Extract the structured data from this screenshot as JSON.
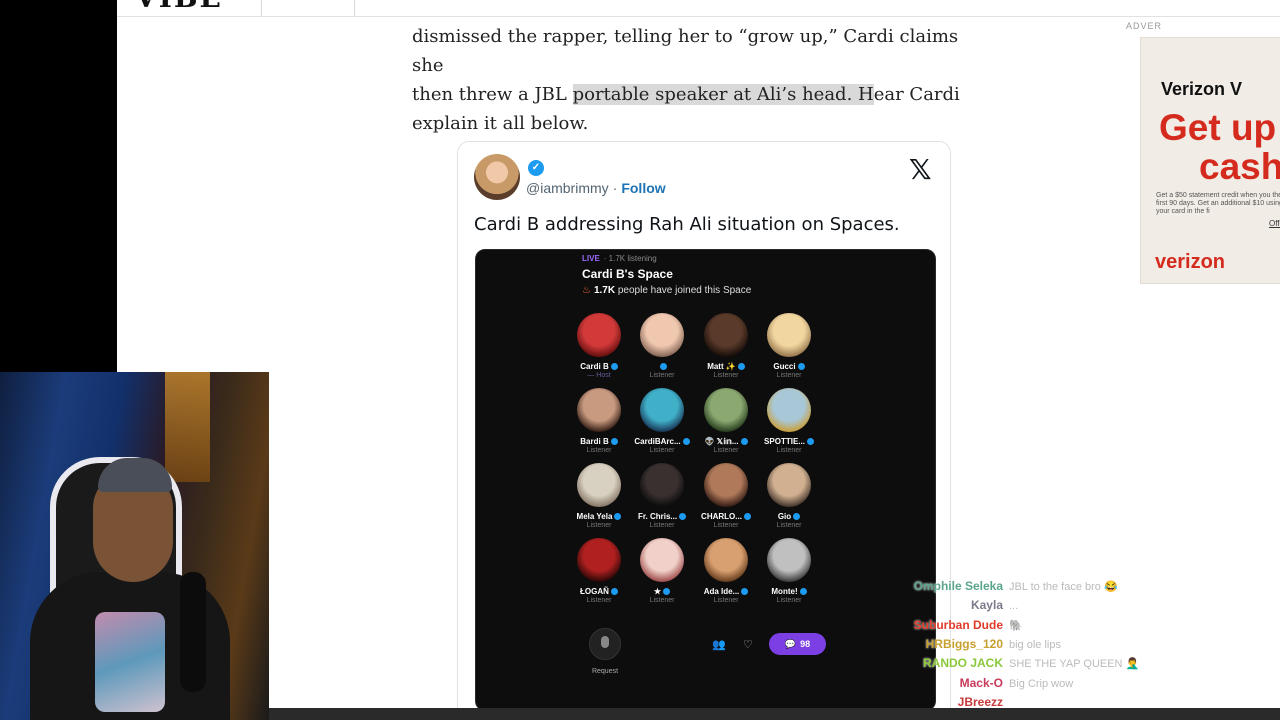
{
  "site": {
    "logo_fragment": "VIBE"
  },
  "article": {
    "line1": "dismissed the rapper, telling her to “grow up,” Cardi claims she",
    "line2_a": "then threw a JBL ",
    "line2_highlight": "portable speaker at Ali’s head. H",
    "line2_b": "ear Cardi",
    "line3": "explain it all below."
  },
  "tweet": {
    "handle": "@iambrimmy",
    "separator": "·",
    "follow_label": "Follow",
    "x_logo": "𝕏",
    "text": "Cardi B addressing Rah Ali situation on Spaces.",
    "space": {
      "live_label": "LIVE",
      "listening": "· 1.7K listening",
      "title": "Cardi B's Space",
      "joined_count": "1.7K",
      "joined_text": " people have joined this Space",
      "participants": [
        {
          "name": "Cardi B",
          "role": "— Host",
          "colors": [
            "#d23a3a",
            "#6a1010"
          ]
        },
        {
          "name": "",
          "role": "Listener",
          "colors": [
            "#f0c8b0",
            "#8a6a5a"
          ]
        },
        {
          "name": "Matt ✨",
          "role": "Listener",
          "colors": [
            "#5a3a2a",
            "#1a0f0a"
          ]
        },
        {
          "name": "Gucci",
          "role": "Listener",
          "colors": [
            "#f1d6a0",
            "#9a7a50"
          ]
        },
        {
          "name": "Bardi B",
          "role": "Listener",
          "colors": [
            "#c89a80",
            "#3a2218"
          ]
        },
        {
          "name": "CardiBArc...",
          "role": "Listener",
          "colors": [
            "#40b0c8",
            "#1a3a5a"
          ]
        },
        {
          "name": "👽 𝕏𝕚𝕟...",
          "role": "Listener",
          "colors": [
            "#8aa870",
            "#2a4020"
          ]
        },
        {
          "name": "SPOTTIE...",
          "role": "Listener",
          "colors": [
            "#a8c8d8",
            "#c8a040"
          ]
        },
        {
          "name": "Mela Yela",
          "role": "Listener",
          "colors": [
            "#d8d0c0",
            "#8a7a6a"
          ]
        },
        {
          "name": "Fr. Chris...",
          "role": "Listener",
          "colors": [
            "#3a3030",
            "#0d0d0d"
          ]
        },
        {
          "name": "CHARLO...",
          "role": "Listener",
          "colors": [
            "#b07a5a",
            "#3a2018"
          ]
        },
        {
          "name": "Gio",
          "role": "Listener",
          "colors": [
            "#d0b090",
            "#4a3a30"
          ]
        },
        {
          "name": "ŁOGAÑ",
          "role": "Listener",
          "colors": [
            "#b02020",
            "#300808"
          ]
        },
        {
          "name": "★",
          "role": "Listener",
          "colors": [
            "#f0d0c8",
            "#a05050"
          ]
        },
        {
          "name": "Ada Ide...",
          "role": "Listener",
          "colors": [
            "#d8a070",
            "#6a4020"
          ]
        },
        {
          "name": "Monte!",
          "role": "Listener",
          "colors": [
            "#c0c0c0",
            "#404040"
          ]
        }
      ],
      "request_label": "Request",
      "reply_count": "98"
    }
  },
  "ad": {
    "label": "ADVER",
    "brand": "Verizon V",
    "headline_1": "Get up",
    "headline_2": "cash",
    "fine_print": "Get a $50 statement credit when you the first 90 days. Get an additional $10 using your card in the fi",
    "cta": "Offe",
    "logo": "verizon"
  },
  "chat": {
    "messages": [
      {
        "user": "Omphile Seleka",
        "msg": "JBL to the face bro 😂",
        "color": "#5aa58a"
      },
      {
        "user": "Kayla",
        "msg": "...",
        "color": "#7a7a8a"
      },
      {
        "user": "Suburban Dude",
        "msg": "🐘",
        "color": "#e03a2a"
      },
      {
        "user": "HRBiggs_120",
        "msg": "big ole lips",
        "color": "#c8a030"
      },
      {
        "user": "RANDO JACK",
        "msg": "SHE THE YAP QUEEN 🤦‍♂️",
        "color": "#8ac83a"
      },
      {
        "user": "Mack-O",
        "msg": "Big Crip wow",
        "color": "#c83a5a"
      },
      {
        "user": "JBreezz",
        "msg": "",
        "color": "#c83a3a"
      }
    ]
  }
}
